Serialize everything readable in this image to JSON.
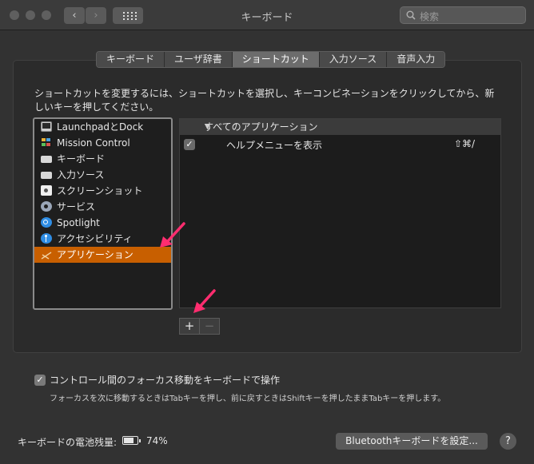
{
  "window": {
    "title": "キーボード"
  },
  "toolbar": {
    "back": "‹",
    "forward": "›"
  },
  "search": {
    "placeholder": "検索"
  },
  "tabs": [
    {
      "label": "キーボード"
    },
    {
      "label": "ユーザ辞書"
    },
    {
      "label": "ショートカット",
      "selected": true
    },
    {
      "label": "入力ソース"
    },
    {
      "label": "音声入力"
    }
  ],
  "instruction": "ショートカットを変更するには、ショートカットを選択し、キーコンビネーションをクリックしてから、新しいキーを押してください。",
  "categories": [
    {
      "label": "LaunchpadとDock",
      "icon": "launchpad-dock-icon"
    },
    {
      "label": "Mission Control",
      "icon": "mission-control-icon"
    },
    {
      "label": "キーボード",
      "icon": "keyboard-icon"
    },
    {
      "label": "入力ソース",
      "icon": "input-source-icon"
    },
    {
      "label": "スクリーンショット",
      "icon": "screenshot-icon"
    },
    {
      "label": "サービス",
      "icon": "gear-icon"
    },
    {
      "label": "Spotlight",
      "icon": "spotlight-icon"
    },
    {
      "label": "アクセシビリティ",
      "icon": "accessibility-icon"
    },
    {
      "label": "アプリケーション",
      "icon": "app-shortcuts-icon",
      "selected": true
    }
  ],
  "shortcuts": {
    "group": "すべてのアプリケーション",
    "items": [
      {
        "name": "ヘルプメニューを表示",
        "keys": "⇧⌘/",
        "checked": true
      }
    ]
  },
  "buttons": {
    "add": "+",
    "remove": "−"
  },
  "focus": {
    "label": "コントロール間のフォーカス移動をキーボードで操作",
    "checked": true,
    "description": "フォーカスを次に移動するときはTabキーを押し、前に戻すときはShiftキーを押したままTabキーを押します。"
  },
  "footer": {
    "battery_label": "キーボードの電池残量:",
    "battery_percent": "74%",
    "battery_level": 0.74,
    "bluetooth_button": "Bluetoothキーボードを設定...",
    "help": "?"
  },
  "colors": {
    "selection": "#c85f00",
    "arrow": "#ff2d6f"
  }
}
